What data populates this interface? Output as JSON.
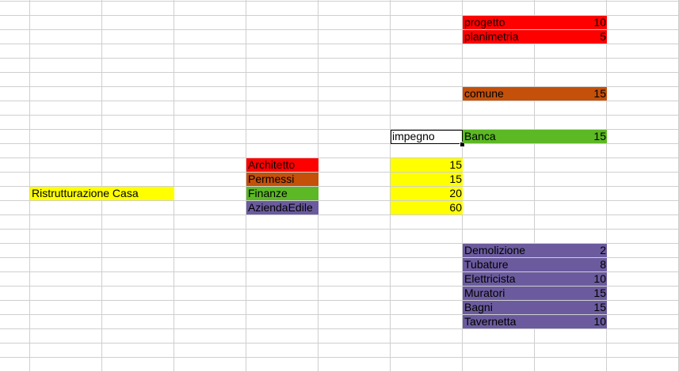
{
  "colors": {
    "red": "#ff0000",
    "brown": "#c4500a",
    "green": "#5cb824",
    "purple": "#6b5b9e",
    "yellow": "#ffff00",
    "grid": "#cfcfcf"
  },
  "sheet": {
    "project_title": "Ristrutturazione Casa",
    "categories": [
      {
        "label": "Architetto",
        "value": "15"
      },
      {
        "label": "Permessi",
        "value": "15"
      },
      {
        "label": "Finanze",
        "value": "20"
      },
      {
        "label": "AziendaEdile",
        "value": "60"
      }
    ],
    "selected_cell": "impegno",
    "architetto_tasks": [
      {
        "label": "progetto",
        "value": "10"
      },
      {
        "label": "planimetria",
        "value": "5"
      }
    ],
    "permessi_tasks": [
      {
        "label": "comune",
        "value": "15"
      }
    ],
    "finanze_tasks": [
      {
        "label": "Banca",
        "value": "15"
      }
    ],
    "azienda_tasks": [
      {
        "label": "Demolizione",
        "value": "2"
      },
      {
        "label": "Tubature",
        "value": "8"
      },
      {
        "label": "Elettricista",
        "value": "10"
      },
      {
        "label": "Muratori",
        "value": "15"
      },
      {
        "label": "Bagni",
        "value": "15"
      },
      {
        "label": "Tavernetta",
        "value": "10"
      }
    ]
  }
}
